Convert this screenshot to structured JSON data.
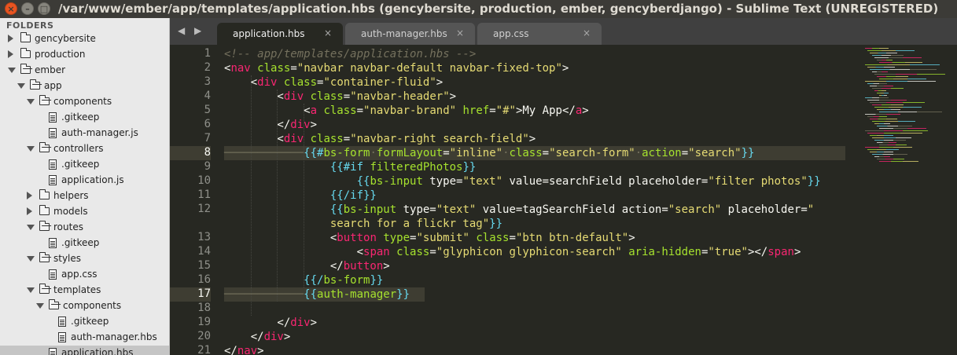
{
  "window": {
    "title": "/var/www/ember/app/templates/application.hbs (gencybersite, production, ember, gencyberdjango) - Sublime Text (UNREGISTERED)",
    "close_glyph": "×",
    "min_glyph": "–",
    "max_glyph": "□"
  },
  "sidebar": {
    "header": "FOLDERS",
    "items": [
      {
        "label": "gencybersite",
        "kind": "folder",
        "expanded": false,
        "depth": 0
      },
      {
        "label": "production",
        "kind": "folder",
        "expanded": false,
        "depth": 0
      },
      {
        "label": "ember",
        "kind": "folder",
        "expanded": true,
        "depth": 0
      },
      {
        "label": "app",
        "kind": "folder",
        "expanded": true,
        "depth": 1
      },
      {
        "label": "components",
        "kind": "folder",
        "expanded": true,
        "depth": 2
      },
      {
        "label": ".gitkeep",
        "kind": "file",
        "depth": 3
      },
      {
        "label": "auth-manager.js",
        "kind": "file",
        "depth": 3
      },
      {
        "label": "controllers",
        "kind": "folder",
        "expanded": true,
        "depth": 2
      },
      {
        "label": ".gitkeep",
        "kind": "file",
        "depth": 3
      },
      {
        "label": "application.js",
        "kind": "file",
        "depth": 3
      },
      {
        "label": "helpers",
        "kind": "folder",
        "expanded": false,
        "depth": 2
      },
      {
        "label": "models",
        "kind": "folder",
        "expanded": false,
        "depth": 2
      },
      {
        "label": "routes",
        "kind": "folder",
        "expanded": true,
        "depth": 2
      },
      {
        "label": ".gitkeep",
        "kind": "file",
        "depth": 3
      },
      {
        "label": "styles",
        "kind": "folder",
        "expanded": true,
        "depth": 2
      },
      {
        "label": "app.css",
        "kind": "file",
        "depth": 3
      },
      {
        "label": "templates",
        "kind": "folder",
        "expanded": true,
        "depth": 2
      },
      {
        "label": "components",
        "kind": "folder",
        "expanded": true,
        "depth": 3
      },
      {
        "label": ".gitkeep",
        "kind": "file",
        "depth": 4
      },
      {
        "label": "auth-manager.hbs",
        "kind": "file",
        "depth": 4
      },
      {
        "label": "application.hbs",
        "kind": "file",
        "depth": 3,
        "selected": true
      }
    ]
  },
  "tabs": {
    "nav_arrows": "◀ ▶",
    "items": [
      {
        "label": "application.hbs",
        "active": true
      },
      {
        "label": "auth-manager.hbs",
        "active": false
      },
      {
        "label": "app.css",
        "active": false
      }
    ],
    "close_glyph": "×"
  },
  "editor": {
    "current_lines": [
      8,
      17
    ],
    "lines": [
      {
        "n": "1",
        "html": "<span class=\"cm\">&lt;!-- app/templates/application.hbs --&gt;</span>"
      },
      {
        "n": "2",
        "html": "&lt;<span class=\"tag\">nav</span> <span class=\"attr\">class</span>=<span class=\"str\">\"navbar navbar-default navbar-fixed-top\"</span>&gt;"
      },
      {
        "n": "3",
        "html": "    &lt;<span class=\"tag\">div</span> <span class=\"attr\">class</span>=<span class=\"str\">\"container-fluid\"</span>&gt;"
      },
      {
        "n": "4",
        "html": "        &lt;<span class=\"tag\">div</span> <span class=\"attr\">class</span>=<span class=\"str\">\"navbar-header\"</span>&gt;"
      },
      {
        "n": "5",
        "html": "            &lt;<span class=\"tag\">a</span> <span class=\"attr\">class</span>=<span class=\"str\">\"navbar-brand\"</span> <span class=\"attr\">href</span>=<span class=\"str\">\"#\"</span>&gt;My App&lt;/<span class=\"tag\">a</span>&gt;"
      },
      {
        "n": "6",
        "html": "        &lt;/<span class=\"tag\">div</span>&gt;"
      },
      {
        "n": "7",
        "html": "        &lt;<span class=\"tag\">div</span> <span class=\"attr\">class</span>=<span class=\"str\">\"navbar-right search-field\"</span>&gt;"
      },
      {
        "n": "8",
        "html": "<span class=\"dash\">────────────</span><span class=\"hb\">{{#</span><span class=\"hbk\">bs-form</span><span class=\"dash\">·</span><span class=\"attr\">formLayout</span>=<span class=\"str\">\"inline\"</span><span class=\"dash\">·</span><span class=\"attr\">class</span>=<span class=\"str\">\"search-form\"</span><span class=\"dash\">·</span><span class=\"attr\">action</span>=<span class=\"str\">\"search\"</span><span class=\"hb\">}}</span>"
      },
      {
        "n": "9",
        "html": "                <span class=\"hb\">{{#if</span> <span class=\"hbk\">filteredPhotos</span><span class=\"hb\">}}</span>"
      },
      {
        "n": "10",
        "html": "                    <span class=\"hb\">{{</span><span class=\"hbk\">bs-input</span> type=<span class=\"str\">\"text\"</span> value=searchField placeholder=<span class=\"str\">\"filter photos\"</span><span class=\"hb\">}}</span>"
      },
      {
        "n": "11",
        "html": "                <span class=\"hb\">{{/if}}</span>"
      },
      {
        "n": "12",
        "html": "                <span class=\"hb\">{{</span><span class=\"hbk\">bs-input</span> type=<span class=\"str\">\"text\"</span> value=tagSearchField action=<span class=\"str\">\"search\"</span> placeholder=<span class=\"str\">\"</span>"
      },
      {
        "n": "",
        "html": "                <span class=\"str\">search for a flickr tag\"</span><span class=\"hb\">}}</span>"
      },
      {
        "n": "13",
        "html": "                &lt;<span class=\"tag\">button</span> <span class=\"attr\">type</span>=<span class=\"str\">\"submit\"</span> <span class=\"attr\">class</span>=<span class=\"str\">\"btn btn-default\"</span>&gt;"
      },
      {
        "n": "14",
        "html": "                    &lt;<span class=\"tag\">span</span> <span class=\"attr\">class</span>=<span class=\"str\">\"glyphicon glyphicon-search\"</span> <span class=\"attr\">aria-hidden</span>=<span class=\"str\">\"true\"</span>&gt;&lt;/<span class=\"tag\">span</span>&gt;"
      },
      {
        "n": "15",
        "html": "                &lt;/<span class=\"tag\">button</span>&gt;"
      },
      {
        "n": "16",
        "html": "            <span class=\"hb\">{{/</span><span class=\"hbk\">bs-form</span><span class=\"hb\">}}</span>"
      },
      {
        "n": "17",
        "html": "<span class=\"dash\">────────────</span><span class=\"hb\">{{</span><span class=\"hbk\">auth-manager</span><span class=\"hb\">}}</span>"
      },
      {
        "n": "18",
        "html": ""
      },
      {
        "n": "19",
        "html": "        &lt;/<span class=\"tag\">div</span>&gt;"
      },
      {
        "n": "20",
        "html": "    &lt;/<span class=\"tag\">div</span>&gt;"
      },
      {
        "n": "21",
        "html": "&lt;/<span class=\"tag\">nav</span>&gt;"
      }
    ]
  },
  "colors": {
    "editor_bg": "#272822",
    "keyword": "#f92672",
    "attribute": "#a6e22e",
    "string": "#e6db74",
    "handlebars": "#66d9ef",
    "comment": "#75715e"
  }
}
